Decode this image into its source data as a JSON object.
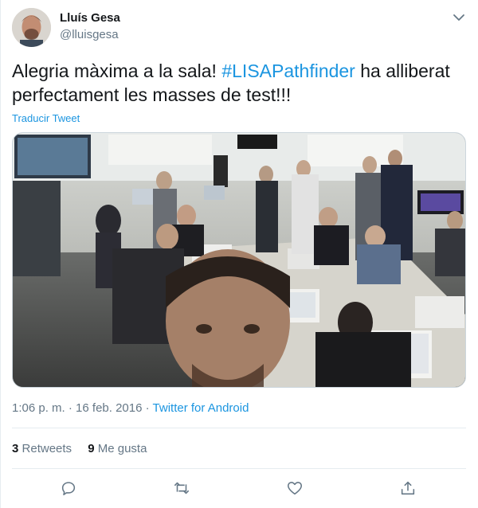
{
  "user": {
    "display_name": "Lluís Gesa",
    "handle": "@lluisgesa"
  },
  "tweet": {
    "text_before": "Alegria màxima a la sala! ",
    "hashtag": "#LISAPathfinder",
    "text_after": " ha alliberat perfectament les masses de test!!!",
    "translate_label": "Traducir Tweet",
    "time": "1:06 p. m.",
    "separator": " · ",
    "date": "16 feb. 2016",
    "source": "Twitter for Android"
  },
  "stats": {
    "retweets_count": "3",
    "retweets_label": "Retweets",
    "likes_count": "9",
    "likes_label": "Me gusta"
  },
  "icons": {
    "caret": "chevron-down-icon",
    "reply": "reply-icon",
    "retweet": "retweet-icon",
    "like": "heart-icon",
    "share": "share-icon"
  },
  "colors": {
    "link": "#1b95e0",
    "secondary_text": "#657786",
    "primary_text": "#14171a",
    "divider": "#e6ecf0"
  }
}
